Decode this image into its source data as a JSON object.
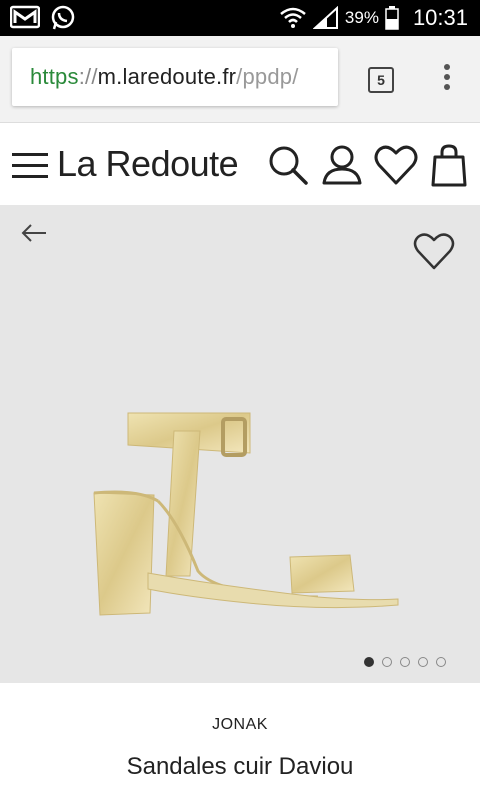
{
  "status_bar": {
    "battery": "39%",
    "time": "10:31",
    "icons": [
      "gmail-icon",
      "whatsapp-icon",
      "wifi-icon",
      "signal-icon",
      "battery-icon"
    ]
  },
  "browser": {
    "url_scheme": "https",
    "url_sep": "://",
    "url_host": "m.laredoute.fr",
    "url_path": "/ppdp/",
    "tab_count": "5"
  },
  "site": {
    "logo": "La Redoute"
  },
  "product": {
    "brand": "JONAK",
    "name": "Sandales cuir Daviou",
    "image_count": 5,
    "active_image": 1
  },
  "colors": {
    "url_scheme_green": "#2a8a3a",
    "hero_bg": "#e6e6e6"
  }
}
